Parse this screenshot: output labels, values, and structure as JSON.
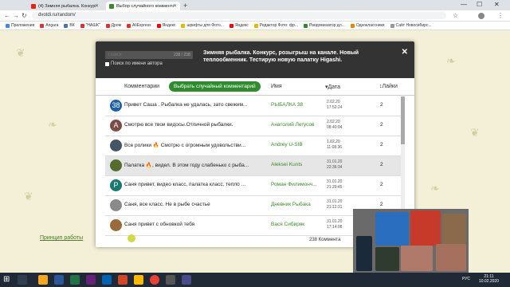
{
  "browser": {
    "tabs": [
      {
        "title": "(4) Зимняя рыбалка. Конкурс, р",
        "active": false
      },
      {
        "title": "Выбор случайного комментар",
        "active": true
      }
    ],
    "url": "dvotdi.ru/random/",
    "bookmarks": [
      "Приложения",
      "Angara",
      "ВК",
      "\"НАШК\"",
      "Дром",
      "AliExpress",
      "Яндекс",
      "шрифты для Фото...",
      "Яндекс",
      "Редактор Фото: фр...",
      "Рандомизатор дл...",
      "Одноклассники",
      "Сайт Новосибирс..."
    ]
  },
  "modal": {
    "search_placeholder": "Поиск",
    "search_count": "238 / 238",
    "by_author_label": "Поиск по имени автора",
    "title": "Зимняя рыбалка. Конкурс, розыгрыш на канале. Новый теплообменник. Тестирую новую палатку Higashi.",
    "close_icon": "close-icon",
    "columns": {
      "comments": "Комментарии",
      "random_button": "Выбрать случайный комментарий",
      "name": "Имя",
      "date": "Дата",
      "likes": "Лайки"
    },
    "rows": [
      {
        "avatar_letter": "38",
        "avatar_color": "#1d5fa8",
        "text": "Привет Саша . Рыбалка не удалась, зато свежим...",
        "author": "РЫБАЛКА 38",
        "date": "2.02.20",
        "time": "17:52:24",
        "likes": "2",
        "selected": false
      },
      {
        "avatar_letter": "А",
        "avatar_color": "#7b4b45",
        "text": "Смотрю все твои видосы.Отличной рыбалки.",
        "author": "Анатолий Легусов",
        "date": "2.02.20",
        "time": "08:40:04",
        "likes": "2",
        "selected": false
      },
      {
        "avatar_letter": "",
        "avatar_color": "#445566",
        "text": "Все ролики 🔥 Смотрю с огромным удовольстви...",
        "author": "Andrey U-SIB",
        "date": "1.02.20",
        "time": "11:08:36",
        "likes": "2",
        "selected": false
      },
      {
        "avatar_letter": "",
        "avatar_color": "#556b2f",
        "text": "Палатка 🔥, видел. В этом году слабенько с рыба...",
        "author": "Aleksei Kunts",
        "date": "31.01.20",
        "time": "22:36:34",
        "likes": "2",
        "selected": true
      },
      {
        "avatar_letter": "Р",
        "avatar_color": "#1a7a6e",
        "text": "Саня привет, видео класс, палатка класс, тепло ...",
        "author": "Роман Филимонч...",
        "date": "31.01.20",
        "time": "21:29:45",
        "likes": "2",
        "selected": false
      },
      {
        "avatar_letter": "",
        "avatar_color": "#8a8a8a",
        "text": "Саня, все класс. Не в рыбе счастье",
        "author": "Дневник Рыбака",
        "date": "31.01.20",
        "time": "21:12:31",
        "likes": "2",
        "selected": false
      },
      {
        "avatar_letter": "",
        "avatar_color": "#9a6a3a",
        "text": "Саня привет с обновкой тебя",
        "author": "Вася Сибиряк",
        "date": "31.01.20",
        "time": "17:14:08",
        "likes": "2",
        "selected": false
      }
    ],
    "footer_count": "238 Коммента"
  },
  "page": {
    "link": "Принцип работы"
  },
  "taskbar": {
    "time": "21:11",
    "date": "10.02.2020",
    "lang": "РУС"
  }
}
